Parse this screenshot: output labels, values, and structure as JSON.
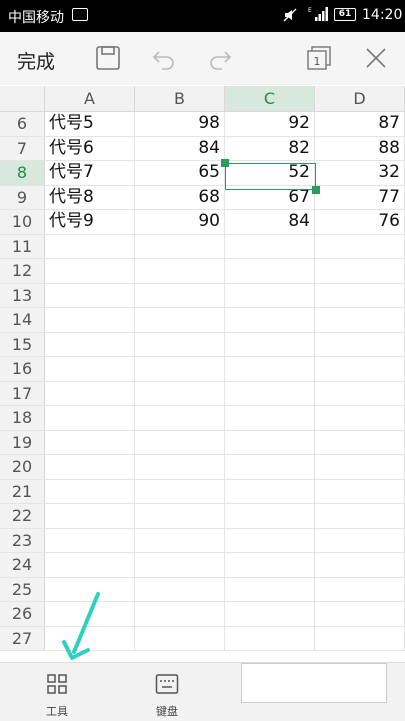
{
  "status_bar": {
    "carrier": "中国移动",
    "battery": "61",
    "network": "E",
    "time": "14:20"
  },
  "toolbar": {
    "done_label": "完成",
    "icons": [
      "save-icon",
      "undo-icon",
      "redo-icon",
      "sheet-count-icon",
      "close-icon"
    ],
    "sheet_count": "1"
  },
  "grid": {
    "columns": [
      "A",
      "B",
      "C",
      "D"
    ],
    "active_column": "C",
    "active_row": "8",
    "rows": [
      {
        "num": "6",
        "cells": [
          "代号5",
          "98",
          "92",
          "87"
        ]
      },
      {
        "num": "7",
        "cells": [
          "代号6",
          "84",
          "82",
          "88"
        ]
      },
      {
        "num": "8",
        "cells": [
          "代号7",
          "65",
          "52",
          "32"
        ]
      },
      {
        "num": "9",
        "cells": [
          "代号8",
          "68",
          "67",
          "77"
        ]
      },
      {
        "num": "10",
        "cells": [
          "代号9",
          "90",
          "84",
          "76"
        ]
      },
      {
        "num": "11",
        "cells": [
          "",
          "",
          "",
          ""
        ]
      },
      {
        "num": "12",
        "cells": [
          "",
          "",
          "",
          ""
        ]
      },
      {
        "num": "13",
        "cells": [
          "",
          "",
          "",
          ""
        ]
      },
      {
        "num": "14",
        "cells": [
          "",
          "",
          "",
          ""
        ]
      },
      {
        "num": "15",
        "cells": [
          "",
          "",
          "",
          ""
        ]
      },
      {
        "num": "16",
        "cells": [
          "",
          "",
          "",
          ""
        ]
      },
      {
        "num": "17",
        "cells": [
          "",
          "",
          "",
          ""
        ]
      },
      {
        "num": "18",
        "cells": [
          "",
          "",
          "",
          ""
        ]
      },
      {
        "num": "19",
        "cells": [
          "",
          "",
          "",
          ""
        ]
      },
      {
        "num": "20",
        "cells": [
          "",
          "",
          "",
          ""
        ]
      },
      {
        "num": "21",
        "cells": [
          "",
          "",
          "",
          ""
        ]
      },
      {
        "num": "22",
        "cells": [
          "",
          "",
          "",
          ""
        ]
      },
      {
        "num": "23",
        "cells": [
          "",
          "",
          "",
          ""
        ]
      },
      {
        "num": "24",
        "cells": [
          "",
          "",
          "",
          ""
        ]
      },
      {
        "num": "25",
        "cells": [
          "",
          "",
          "",
          ""
        ]
      },
      {
        "num": "26",
        "cells": [
          "",
          "",
          "",
          ""
        ]
      },
      {
        "num": "27",
        "cells": [
          "",
          "",
          "",
          ""
        ]
      }
    ]
  },
  "bottom_bar": {
    "tools_label": "工具",
    "keyboard_label": "键盘"
  },
  "colors": {
    "accent": "#2a9d5a",
    "annotation_arrow": "#2fd0c0"
  }
}
